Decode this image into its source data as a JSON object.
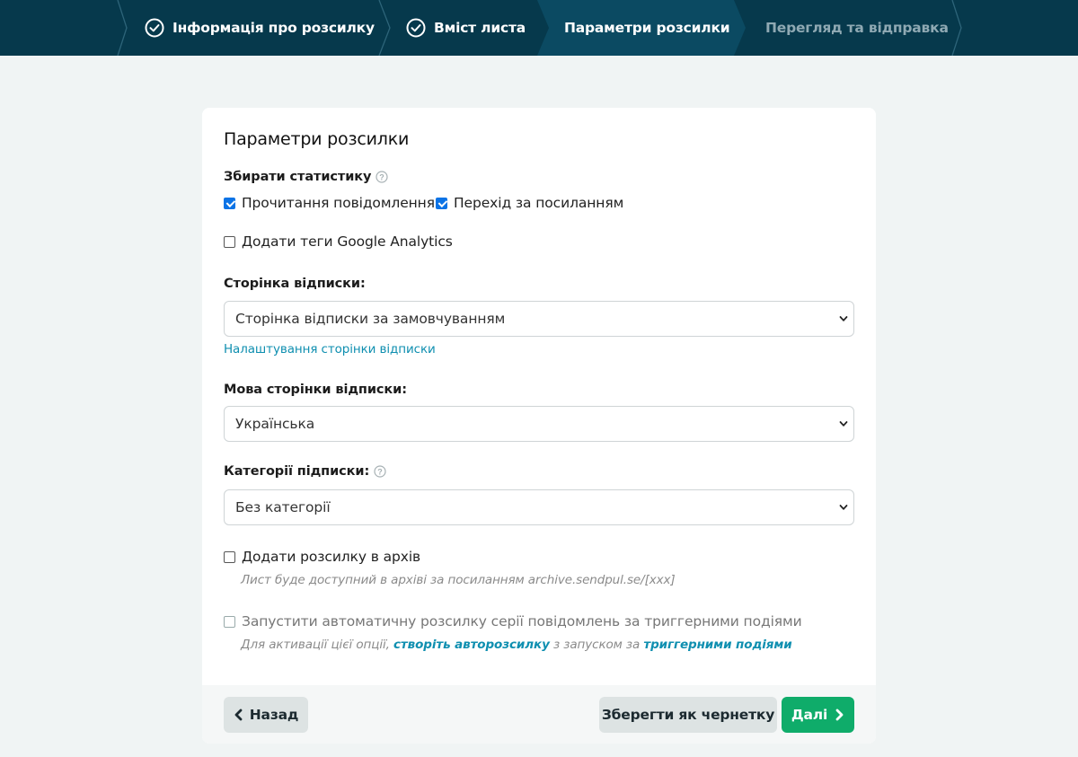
{
  "stepper": {
    "steps": [
      {
        "label": "Інформація про розсилку",
        "state": "done"
      },
      {
        "label": "Вміст листа",
        "state": "done"
      },
      {
        "label": "Параметри розсилки",
        "state": "active"
      },
      {
        "label": "Перегляд та відправка",
        "state": "pending"
      }
    ]
  },
  "card": {
    "title": "Параметри розсилки",
    "stats": {
      "label": "Збирати статистику",
      "read_label": "Прочитання повідомлення",
      "read_checked": true,
      "click_label": "Перехід за посиланням",
      "click_checked": true
    },
    "ga": {
      "label": "Додати теги Google Analytics",
      "checked": false
    },
    "unsub_page": {
      "label": "Сторінка відписки:",
      "selected": "Сторінка відписки за замовчуванням",
      "settings_link": "Налаштування сторінки відписки"
    },
    "unsub_lang": {
      "label": "Мова сторінки відписки:",
      "selected": "Українська"
    },
    "categories": {
      "label": "Категорії підписки:",
      "selected": "Без категорії"
    },
    "archive": {
      "label": "Додати розсилку в архів",
      "checked": false,
      "hint": "Лист буде доступний в архіві за посиланням archive.sendpul.se/[xxx]"
    },
    "trigger": {
      "label": "Запустити автоматичну розсилку серії повідомлень за триггерними подіями",
      "checked": false,
      "hint_prefix": "Для активації цієї опції,",
      "hint_link1": "створіть авторозсилку",
      "hint_middle": "з запуском за",
      "hint_link2": "триггерними подіями"
    }
  },
  "footer": {
    "back_label": "Назад",
    "draft_label": "Зберегти як чернетку",
    "next_label": "Далі"
  },
  "colors": {
    "header_bg": "#06394c",
    "active_step_bg": "#0b4a62",
    "accent_link": "#0f8fb0",
    "next_button": "#0fac6a"
  }
}
